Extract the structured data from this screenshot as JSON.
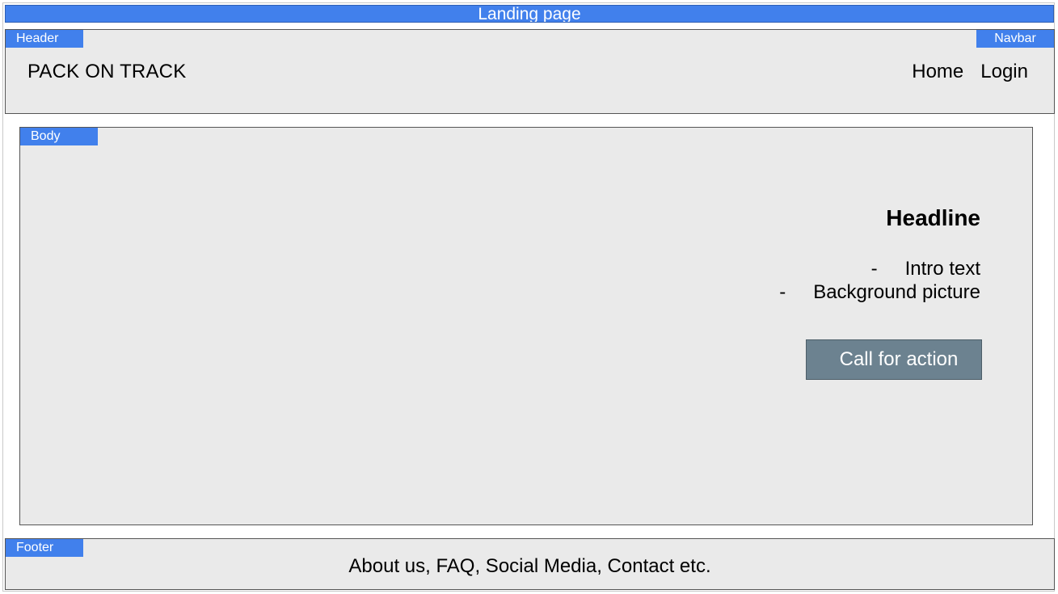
{
  "title": "Landing page",
  "header": {
    "tag": "Header",
    "navbar_tag": "Navbar",
    "logo": "PACK ON TRACK",
    "nav": [
      {
        "label": "Home"
      },
      {
        "label": "Login"
      }
    ]
  },
  "body": {
    "tag": "Body",
    "headline": "Headline",
    "bullets": [
      {
        "dash": "-",
        "text": "Intro text"
      },
      {
        "dash": "-",
        "text": "Background picture"
      }
    ],
    "cta_label": "Call for action"
  },
  "footer": {
    "tag": "Footer",
    "text": "About us, FAQ, Social Media, Contact etc."
  }
}
